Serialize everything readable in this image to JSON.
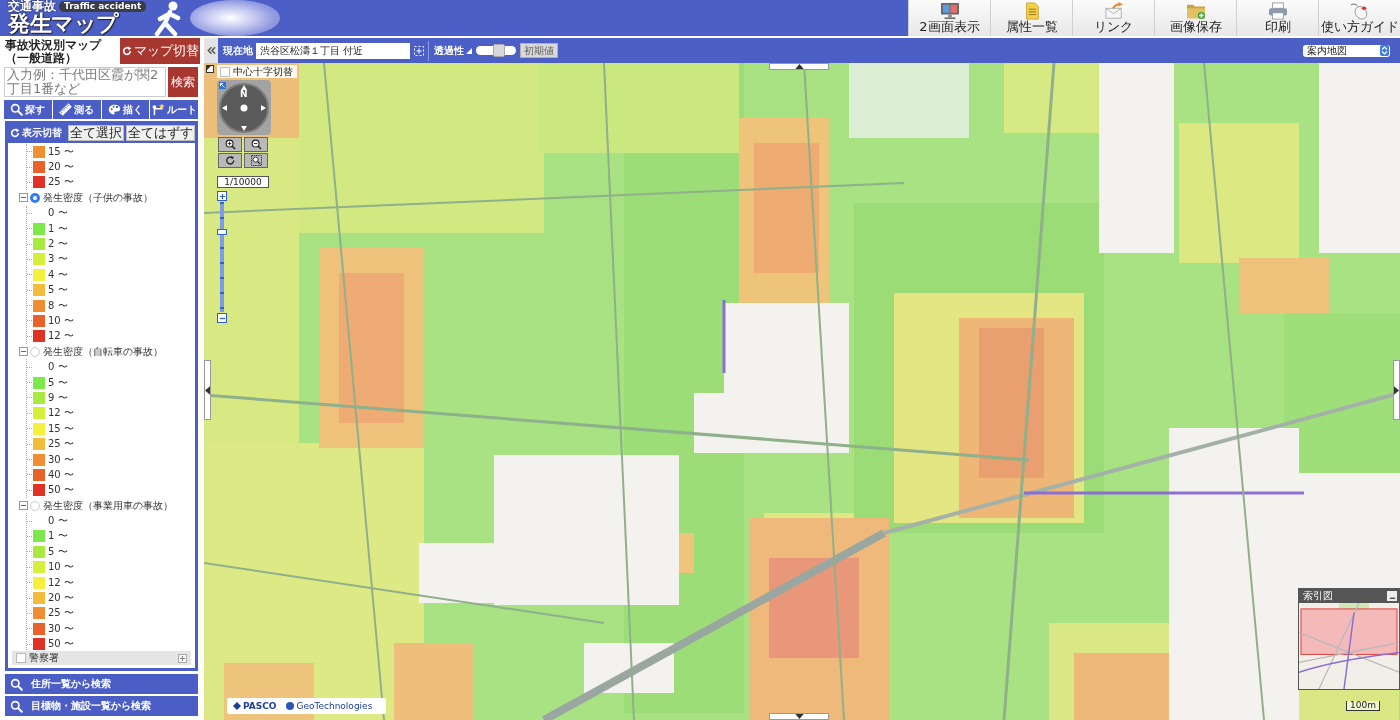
{
  "header": {
    "logo_top": "交通事故",
    "logo_badge": "Traffic accident",
    "logo_main": "発生マップ"
  },
  "toolbar": [
    {
      "label": "2画面表示"
    },
    {
      "label": "属性一覧"
    },
    {
      "label": "リンク"
    },
    {
      "label": "画像保存"
    },
    {
      "label": "印刷"
    },
    {
      "label": "使い方ガイド"
    }
  ],
  "sidebar": {
    "title": "事故状況別マップ（一般道路）",
    "switch_button": "マップ切替",
    "search": {
      "placeholder": "入力例：千代田区霞が関2丁目1番など",
      "button": "検索"
    },
    "tools": [
      "探す",
      "測る",
      "描く",
      "ルート"
    ],
    "layer_panel": {
      "title": "表示切替",
      "select_all": "全て選択",
      "clear_all": "全てはずす",
      "top_items": [
        {
          "label": "15 〜",
          "color": "#ef8f32"
        },
        {
          "label": "20 〜",
          "color": "#e8622a"
        },
        {
          "label": "25 〜",
          "color": "#df3224"
        }
      ],
      "groups": [
        {
          "label": "発生密度（子供の事故）",
          "selected": true,
          "expanded": true,
          "items": [
            {
              "label": "0 〜"
            },
            {
              "label": "1 〜",
              "color": "#7de84b"
            },
            {
              "label": "2 〜",
              "color": "#a8ea3f"
            },
            {
              "label": "3 〜",
              "color": "#d5ef3b"
            },
            {
              "label": "4 〜",
              "color": "#f5f03e"
            },
            {
              "label": "5 〜",
              "color": "#f3bd3b"
            },
            {
              "label": "8 〜",
              "color": "#ef8e32"
            },
            {
              "label": "10 〜",
              "color": "#e8632b"
            },
            {
              "label": "12 〜",
              "color": "#df3224"
            }
          ]
        },
        {
          "label": "発生密度（自転車の事故）",
          "selected": false,
          "expanded": true,
          "items": [
            {
              "label": "0 〜"
            },
            {
              "label": "5 〜",
              "color": "#7de84b"
            },
            {
              "label": "9 〜",
              "color": "#a8ea3f"
            },
            {
              "label": "12 〜",
              "color": "#d5ef3b"
            },
            {
              "label": "15 〜",
              "color": "#f5f03e"
            },
            {
              "label": "25 〜",
              "color": "#f3bd3b"
            },
            {
              "label": "30 〜",
              "color": "#ef8e32"
            },
            {
              "label": "40 〜",
              "color": "#e8632b"
            },
            {
              "label": "50 〜",
              "color": "#df3224"
            }
          ]
        },
        {
          "label": "発生密度（事業用車の事故）",
          "selected": false,
          "expanded": true,
          "items": [
            {
              "label": "0 〜"
            },
            {
              "label": "1 〜",
              "color": "#7de84b"
            },
            {
              "label": "5 〜",
              "color": "#a8ea3f"
            },
            {
              "label": "10 〜",
              "color": "#d5ef3b"
            },
            {
              "label": "12 〜",
              "color": "#f5f03e"
            },
            {
              "label": "20 〜",
              "color": "#f3bd3b"
            },
            {
              "label": "25 〜",
              "color": "#ef8e32"
            },
            {
              "label": "30 〜",
              "color": "#e8632b"
            },
            {
              "label": "50 〜",
              "color": "#df3224"
            }
          ]
        }
      ],
      "police": {
        "label": "警察署",
        "checked": false,
        "expanded": false
      }
    },
    "search_links": [
      "住所一覧から検索",
      "目標物・施設一覧から検索"
    ]
  },
  "location_bar": {
    "label": "現在地",
    "value": "渋谷区松濤１丁目 付近",
    "opacity_label": "透過性",
    "opacity": {
      "level": 0.6
    },
    "reset_button": {
      "label": "初期値",
      "disabled": true
    },
    "map_type": "案内地図"
  },
  "map": {
    "crosshair_toggle": {
      "label": "中心十字切替",
      "checked": false
    },
    "north_label": "N",
    "scale": "1/10000",
    "zoom": {
      "level": 0.74
    },
    "credits": [
      "PASCO",
      "GeoTechnologies"
    ],
    "overview": {
      "title": "索引図"
    },
    "scale_bar": "100m"
  }
}
